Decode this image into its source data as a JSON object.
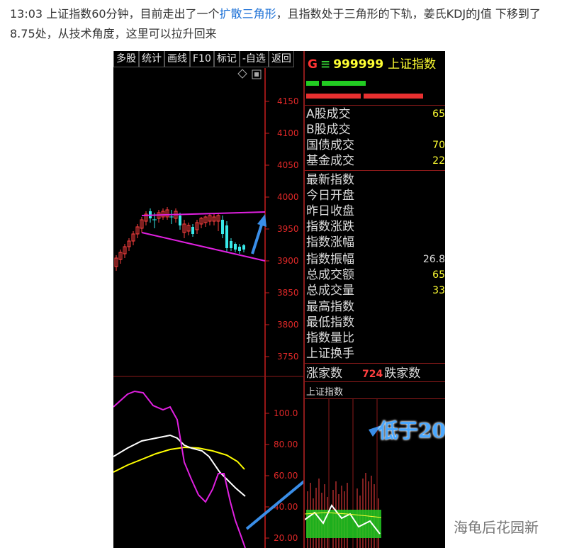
{
  "article": {
    "text_before_link": "13:03 上证指数60分钟，目前走出了一个",
    "link_text": "扩散三角形",
    "text_after_link": "，且指数处于三角形的下轨，姜氏KDJ的J值 下移到了8.75处，从技术角度，这里可以拉升回来"
  },
  "toolbar": {
    "buttons": [
      "多股",
      "统计",
      "画线",
      "F10",
      "标记",
      "-自选",
      "返回"
    ]
  },
  "panel": {
    "g_label": "G",
    "eq_label": "≡",
    "code": "999999",
    "name": "上证指数",
    "rows_trade": [
      {
        "label": "A股成交",
        "value": "65"
      },
      {
        "label": "B股成交",
        "value": ""
      },
      {
        "label": "国债成交",
        "value": "70"
      },
      {
        "label": "基金成交",
        "value": "22"
      }
    ],
    "rows_index": [
      {
        "label": "最新指数",
        "value": ""
      },
      {
        "label": "今日开盘",
        "value": ""
      },
      {
        "label": "昨日收盘",
        "value": ""
      },
      {
        "label": "指数涨跌",
        "value": ""
      },
      {
        "label": "指数涨幅",
        "value": ""
      },
      {
        "label": "指数振幅",
        "value": "26.8"
      },
      {
        "label": "总成交额",
        "value": "65"
      },
      {
        "label": "总成交量",
        "value": "33"
      },
      {
        "label": "最高指数",
        "value": ""
      },
      {
        "label": "最低指数",
        "value": ""
      },
      {
        "label": "指数量比",
        "value": ""
      },
      {
        "label": "上证换手",
        "value": ""
      }
    ],
    "up_label": "涨家数",
    "up_count": "724",
    "down_label": "跌家数",
    "mini_chart_title": "上证指数"
  },
  "chart": {
    "price_ticks": [
      "4150",
      "4100",
      "4050",
      "4000",
      "3950",
      "3900",
      "3850",
      "3800",
      "3750"
    ],
    "kdj_ticks": [
      "100.0",
      "80.00",
      "60.00",
      "40.00",
      "20.00"
    ],
    "callout": "低于20"
  },
  "watermark": "海龟后花园新",
  "colors": {
    "background": "#000000",
    "axis_red": "#c81e1e",
    "tick_text": "#e02828",
    "triangle_magenta": "#e020e0",
    "candle_up": "#ff4040",
    "candle_down": "#38e8e8",
    "kdj_k": "#ffffff",
    "kdj_d": "#ffff00",
    "kdj_j": "#e020e0",
    "arrow_blue": "#3a8ee8",
    "link_blue": "#1a6fd6"
  }
}
